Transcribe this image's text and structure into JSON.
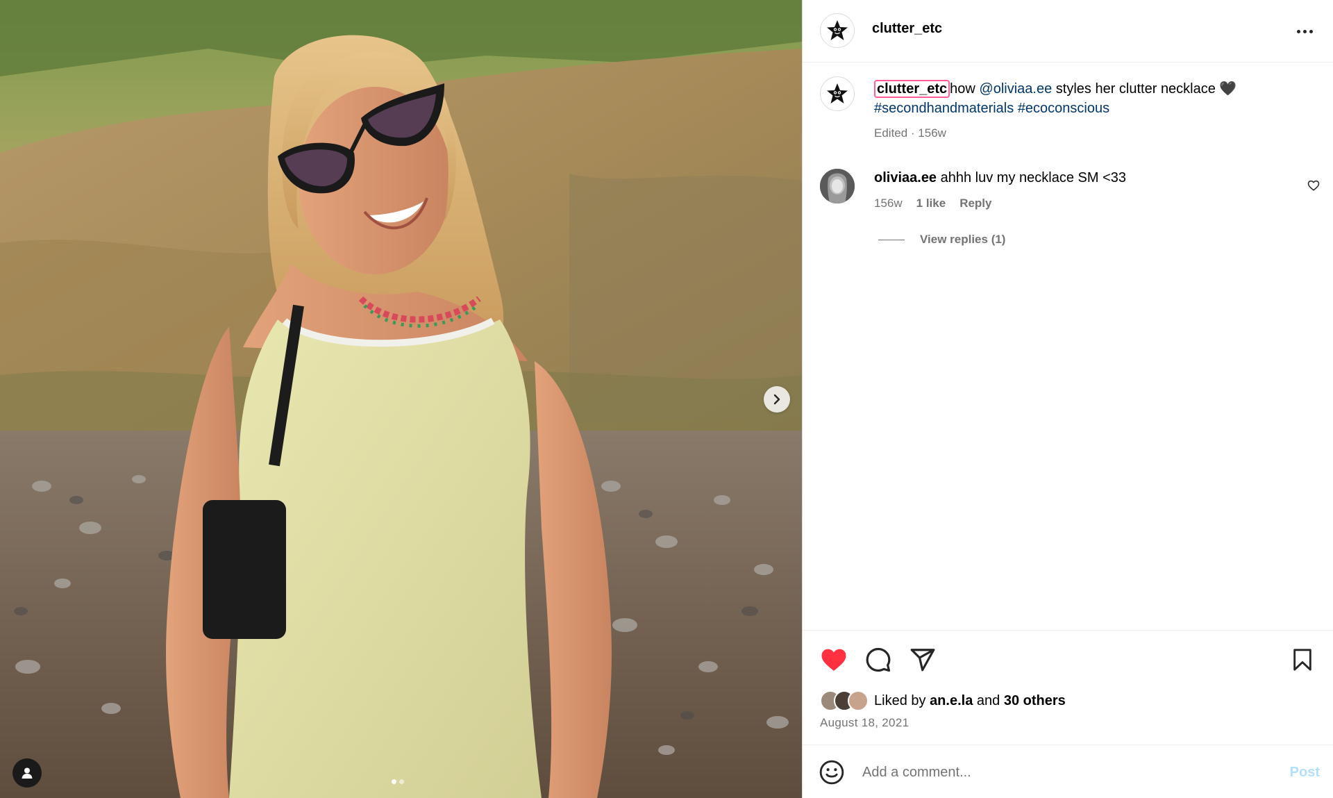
{
  "post": {
    "username": "clutter_etc",
    "avatar_icon": "star-character-icon"
  },
  "caption": {
    "username": "clutter_etc",
    "text_before": "how ",
    "mention": "@oliviaa.ee",
    "text_after": " styles her clutter necklace 🖤",
    "hashtag1": "#secondhandmaterials",
    "hashtag2": "#ecoconscious",
    "meta": "Edited · 156w"
  },
  "comment": {
    "username": "oliviaa.ee",
    "text": "ahhh luv my necklace SM <33",
    "age": "156w",
    "likes": "1 like",
    "reply": "Reply",
    "view_replies": "View replies (1)"
  },
  "likes": {
    "prefix": "Liked by",
    "user": "an.e.la",
    "and": "and",
    "others": "30 others"
  },
  "date": "August 18, 2021",
  "comment_box": {
    "placeholder": "Add a comment...",
    "post_label": "Post"
  },
  "carousel": {
    "total_slides": 2,
    "active_slide": 1
  },
  "colors": {
    "like_red": "#ff3040",
    "link_blue": "#00376b",
    "post_disabled": "#b2dffc",
    "mention_outline": "#ff5c9a"
  }
}
